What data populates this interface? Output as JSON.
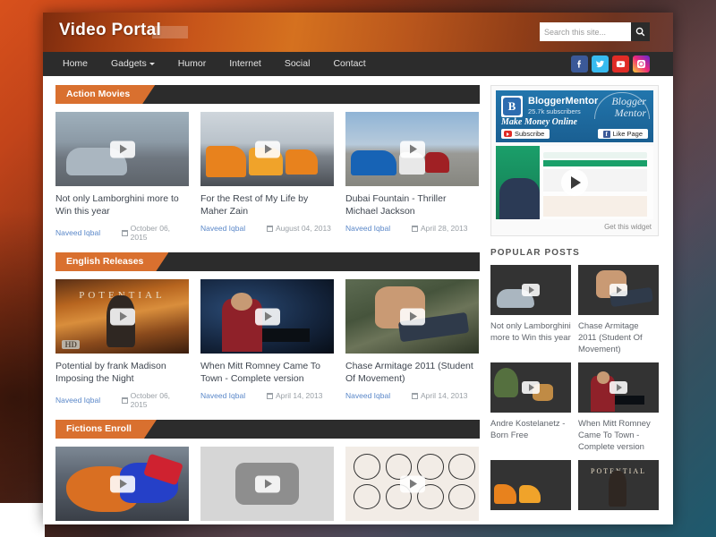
{
  "site": {
    "title": "Video Portal",
    "search_placeholder": "Search this site...",
    "search_value": "",
    "search_icon": "search-icon"
  },
  "nav": {
    "items": [
      {
        "label": "Home",
        "has_caret": false
      },
      {
        "label": "Gadgets",
        "has_caret": true
      },
      {
        "label": "Humor",
        "has_caret": false
      },
      {
        "label": "Internet",
        "has_caret": false
      },
      {
        "label": "Social",
        "has_caret": false
      },
      {
        "label": "Contact",
        "has_caret": false
      }
    ],
    "social": [
      {
        "name": "facebook-icon",
        "color": "#3b5998"
      },
      {
        "name": "twitter-icon",
        "color": "#37bbf0"
      },
      {
        "name": "youtube-icon",
        "color": "#e02c26"
      },
      {
        "name": "instagram-icon",
        "color": "#ee2a7b"
      }
    ]
  },
  "colors": {
    "accent": "#d9702f",
    "dark_bar": "#2c2c2c",
    "link": "#5b88c9",
    "meta": "#9aa0a6"
  },
  "sections": [
    {
      "title": "Action Movies",
      "posts": [
        {
          "title": "Not only Lamborghini more to Win this year",
          "author": "Naveed Iqbal",
          "date": "October 06, 2015"
        },
        {
          "title": "For the Rest of My Life by Maher Zain",
          "author": "Naveed Iqbal",
          "date": "August 04, 2013"
        },
        {
          "title": "Dubai Fountain - Thriller Michael Jackson",
          "author": "Naveed Iqbal",
          "date": "April 28, 2013"
        }
      ]
    },
    {
      "title": "English Releases",
      "posts": [
        {
          "title": "Potential by frank Madison Imposing the Night",
          "author": "Naveed Iqbal",
          "date": "October 06, 2015"
        },
        {
          "title": "When Mitt Romney Came To Town - Complete version",
          "author": "Naveed Iqbal",
          "date": "April 14, 2013"
        },
        {
          "title": "Chase Armitage 2011 (Student Of Movement)",
          "author": "Naveed Iqbal",
          "date": "April 14, 2013"
        }
      ]
    },
    {
      "title": "Fictions Enroll",
      "posts": [
        {
          "title": "",
          "author": "",
          "date": ""
        },
        {
          "title": "",
          "author": "",
          "date": ""
        },
        {
          "title": "",
          "author": "",
          "date": ""
        }
      ]
    }
  ],
  "sidebar": {
    "widget": {
      "channel_name": "BloggerMentor",
      "subscribers": "25.7k subscribers",
      "tagline": "Make Money Online",
      "subscribe_label": "Subscribe",
      "like_label": "Like Page",
      "script_line1": "Blogger",
      "script_line2": "Mentor",
      "get_widget": "Get this widget"
    },
    "popular": {
      "heading": "POPULAR POSTS",
      "posts": [
        {
          "title": "Not only Lamborghini more to Win this year"
        },
        {
          "title": "Chase Armitage 2011 (Student Of Movement)"
        },
        {
          "title": "Andre Kostelanetz - Born Free"
        },
        {
          "title": "When Mitt Romney Came To Town - Complete version"
        },
        {
          "title": ""
        },
        {
          "title": ""
        }
      ]
    }
  }
}
